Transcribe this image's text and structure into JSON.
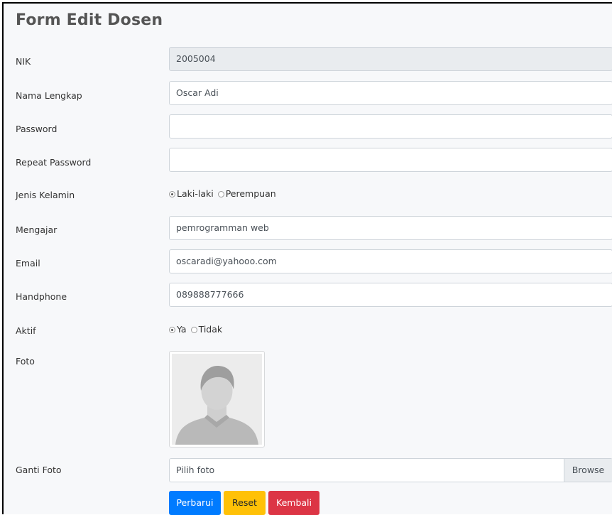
{
  "form": {
    "title": "Form Edit Dosen",
    "nik": {
      "label": "NIK",
      "value": "2005004"
    },
    "nama": {
      "label": "Nama Lengkap",
      "value": "Oscar Adi"
    },
    "password": {
      "label": "Password",
      "value": ""
    },
    "repeat_password": {
      "label": "Repeat Password",
      "value": ""
    },
    "jenis_kelamin": {
      "label": "Jenis Kelamin",
      "options": [
        "Laki-laki",
        "Perempuan"
      ],
      "selected": "Laki-laki"
    },
    "mengajar": {
      "label": "Mengajar",
      "value": "pemrogramman web"
    },
    "email": {
      "label": "Email",
      "value": "oscaradi@yahooo.com"
    },
    "handphone": {
      "label": "Handphone",
      "value": "089888777666"
    },
    "aktif": {
      "label": "Aktif",
      "options": [
        "Ya",
        "Tidak"
      ],
      "selected": "Ya"
    },
    "foto": {
      "label": "Foto",
      "image": "default-avatar-placeholder"
    },
    "ganti_foto": {
      "label": "Ganti Foto",
      "placeholder": "Pilih foto",
      "browse_label": "Browse"
    },
    "buttons": {
      "perbarui": "Perbarui",
      "reset": "Reset",
      "kembali": "Kembali"
    }
  },
  "colors": {
    "primary": "#007bff",
    "warning": "#ffc107",
    "danger": "#dc3545",
    "readonly_bg": "#e9ecef"
  }
}
